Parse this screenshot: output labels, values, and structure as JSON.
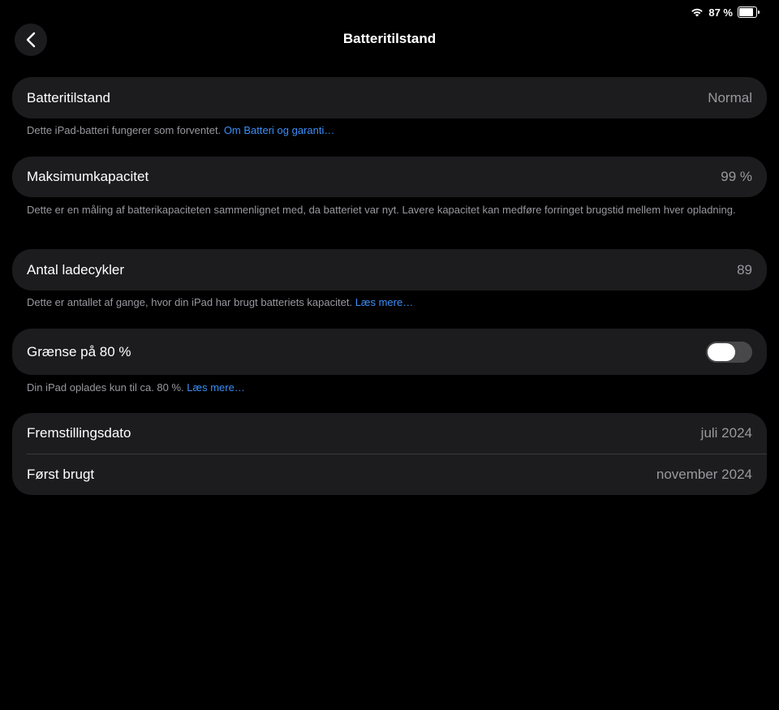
{
  "status_bar": {
    "battery_percent_text": "87 %",
    "battery_level": 0.87
  },
  "nav": {
    "title": "Batteritilstand"
  },
  "sections": {
    "health": {
      "label": "Batteritilstand",
      "value": "Normal",
      "footnote_text": "Dette iPad-batteri fungerer som forventet.",
      "footnote_link": "Om Batteri og garanti…"
    },
    "capacity": {
      "label": "Maksimumkapacitet",
      "value": "99 %",
      "footnote_text": "Dette er en måling af batterikapaciteten sammenlignet med, da batteriet var nyt. Lavere kapacitet kan medføre forringet brugstid mellem hver opladning."
    },
    "cycles": {
      "label": "Antal ladecykler",
      "value": "89",
      "footnote_text": "Dette er antallet af gange, hvor din iPad har brugt batteriets kapacitet.",
      "footnote_link": "Læs mere…"
    },
    "limit": {
      "label": "Grænse på 80 %",
      "toggle_on": false,
      "footnote_text": "Din iPad oplades kun til ca. 80 %.",
      "footnote_link": "Læs mere…"
    },
    "dates": {
      "manufactured_label": "Fremstillingsdato",
      "manufactured_value": "juli 2024",
      "first_use_label": "Først brugt",
      "first_use_value": "november 2024"
    }
  },
  "icons": {
    "back": "chevron-left-icon",
    "wifi": "wifi-icon",
    "battery": "battery-icon"
  }
}
